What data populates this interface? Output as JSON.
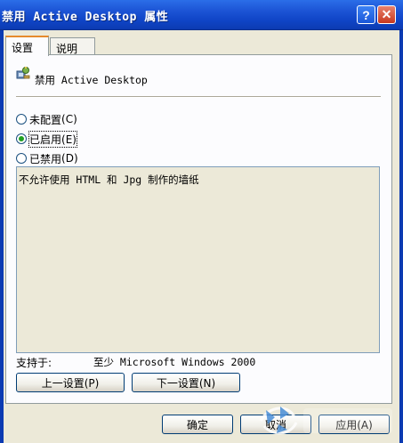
{
  "window": {
    "title": "禁用 Active Desktop 属性",
    "help_glyph": "?",
    "close_glyph": "✕"
  },
  "tabs": [
    {
      "label": "设置",
      "active": true
    },
    {
      "label": "说明",
      "active": false
    }
  ],
  "policy": {
    "name": "禁用 Active Desktop",
    "icon": "policy-settings-icon"
  },
  "options": [
    {
      "label": "未配置",
      "shortcut": "(C)",
      "selected": false
    },
    {
      "label": "已启用",
      "shortcut": "(E)",
      "selected": true
    },
    {
      "label": "已禁用",
      "shortcut": "(D)",
      "selected": false
    }
  ],
  "comment": "不允许使用 HTML 和 Jpg 制作的墙纸",
  "support": {
    "label": "支持于:",
    "value": "至少 Microsoft Windows 2000"
  },
  "nav_buttons": {
    "prev": "上一设置(P)",
    "next": "下一设置(N)"
  },
  "dialog_buttons": {
    "ok": "确定",
    "cancel": "取消",
    "apply": "应用(A)"
  },
  "colors": {
    "titlebar": "#0F44C6",
    "dialog_bg": "#ECE9D8",
    "tab_accent": "#E68B2C"
  }
}
